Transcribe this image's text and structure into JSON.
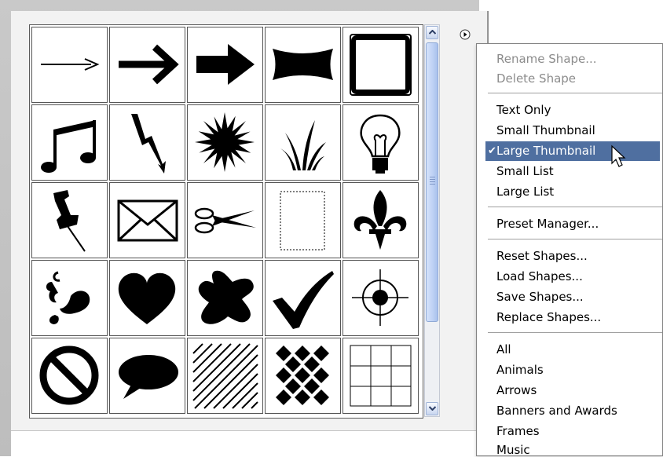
{
  "shapes": [
    "arrow-thin-icon",
    "arrow-bold-icon",
    "arrow-block-icon",
    "banner-icon",
    "frame-icon",
    "music-notes-icon",
    "lightning-icon",
    "starburst-icon",
    "grass-icon",
    "lightbulb-icon",
    "pushpin-icon",
    "envelope-icon",
    "scissors-icon",
    "stamp-frame-icon",
    "fleur-de-lis-icon",
    "ornament-heart-icon",
    "heart-icon",
    "splat-icon",
    "checkmark-icon",
    "target-icon",
    "no-symbol-icon",
    "speech-bubble-icon",
    "diagonal-lines-icon",
    "checkerboard-icon",
    "grid-icon"
  ],
  "menu": {
    "rename": "Rename Shape...",
    "delete": "Delete Shape",
    "text_only": "Text Only",
    "small_thumb": "Small Thumbnail",
    "large_thumb": "Large Thumbnail",
    "small_list": "Small List",
    "large_list": "Large List",
    "preset_manager": "Preset Manager...",
    "reset": "Reset Shapes...",
    "load": "Load Shapes...",
    "save": "Save Shapes...",
    "replace": "Replace Shapes...",
    "all": "All",
    "animals": "Animals",
    "arrows": "Arrows",
    "banners": "Banners and Awards",
    "frames": "Frames",
    "music": "Music",
    "check_mark": "✔"
  },
  "colors": {
    "selection": "#4f6fa0",
    "disabled_text": "#8c8c8c"
  }
}
